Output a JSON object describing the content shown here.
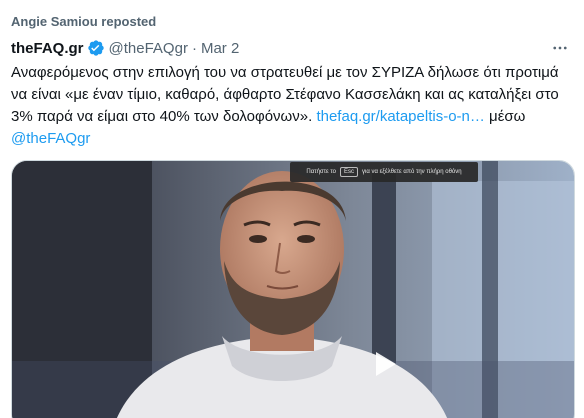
{
  "repost": {
    "text": "Angie Samiou reposted"
  },
  "tweet": {
    "display_name": "theFAQ.gr",
    "handle": "@theFAQgr",
    "separator": "·",
    "date": "Mar 2",
    "body": "Αναφερόμενος στην επιλογή του να στρατευθεί με τον ΣΥΡΙΖΑ δήλωσε ότι προτιμά να είναι «με έναν τίμιο, καθαρό, άφθαρτο Στέφανο Κασσελάκη και ας καταλήξει στο 3% παρά να είμαι στο 40% των δολοφόνων».",
    "link_text": "thefaq.gr/katapeltis-o-n…",
    "via_text": "μέσω",
    "via_handle": "@theFAQgr"
  },
  "media": {
    "esc_prefix": "Πατήστε το",
    "esc_key": "Esc",
    "esc_suffix": "για να εξέλθετε από την πλήρη οθόνη"
  },
  "icons": {
    "verified": "verified-badge-icon",
    "more": "more-options-icon",
    "play": "play-icon"
  },
  "colors": {
    "accent": "#1d9bf0",
    "secondary_text": "#536471",
    "primary_text": "#0f1419"
  }
}
